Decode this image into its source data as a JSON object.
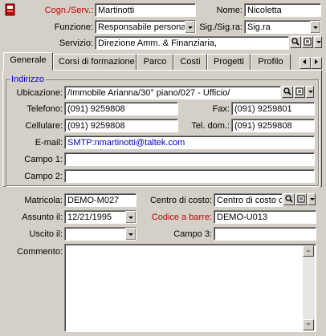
{
  "header": {
    "cognome_label": "Cogn./Serv.:",
    "cognome_value": "Martinotti",
    "nome_label": "Nome:",
    "nome_value": "Nicoletta",
    "funzione_label": "Funzione:",
    "funzione_value": "Responsabile personale",
    "sigsigra_label": "Sig./Sig.ra:",
    "sigsigra_value": "Sig.ra",
    "servizio_label": "Servizio:",
    "servizio_value": "Direzione Amm. & Finanziaria,"
  },
  "tabs": [
    {
      "label": "Generale",
      "active": true
    },
    {
      "label": "Corsi di formazione"
    },
    {
      "label": "Parco"
    },
    {
      "label": "Costi"
    },
    {
      "label": "Progetti"
    },
    {
      "label": "Profilo"
    }
  ],
  "indirizzo": {
    "title": "Indirizzo",
    "ubicazione_label": "Ubicazione:",
    "ubicazione_value": "/Immobile Arianna/30° piano/027 - Ufficio/",
    "telefono_label": "Telefono:",
    "telefono_value": "(091) 9259808",
    "fax_label": "Fax:",
    "fax_value": "(091) 9259801",
    "cellulare_label": "Cellulare:",
    "cellulare_value": "(091) 9259808",
    "teldom_label": "Tel. dom.:",
    "teldom_value": "(091) 9259808",
    "email_label": "E-mail:",
    "email_value": "SMTP:nmartinotti@taltek.com",
    "campo1_label": "Campo 1:",
    "campo1_value": "",
    "campo2_label": "Campo 2:",
    "campo2_value": ""
  },
  "bottom": {
    "matricola_label": "Matricola:",
    "matricola_value": "DEMO-M027",
    "centro_label": "Centro di costo:",
    "centro_value": "Centro di costo co",
    "assunto_label": "Assunto il:",
    "assunto_value": "12/21/1995",
    "codice_label": "Codice a barre:",
    "codice_value": "DEMO-U013",
    "uscito_label": "Uscito il:",
    "uscito_value": "",
    "campo3_label": "Campo 3:",
    "campo3_value": "",
    "commento_label": "Commento:",
    "commento_value": ""
  },
  "colors": {
    "background": "#d4d0c8",
    "required_label": "#c00000",
    "link": "#0000c0"
  }
}
